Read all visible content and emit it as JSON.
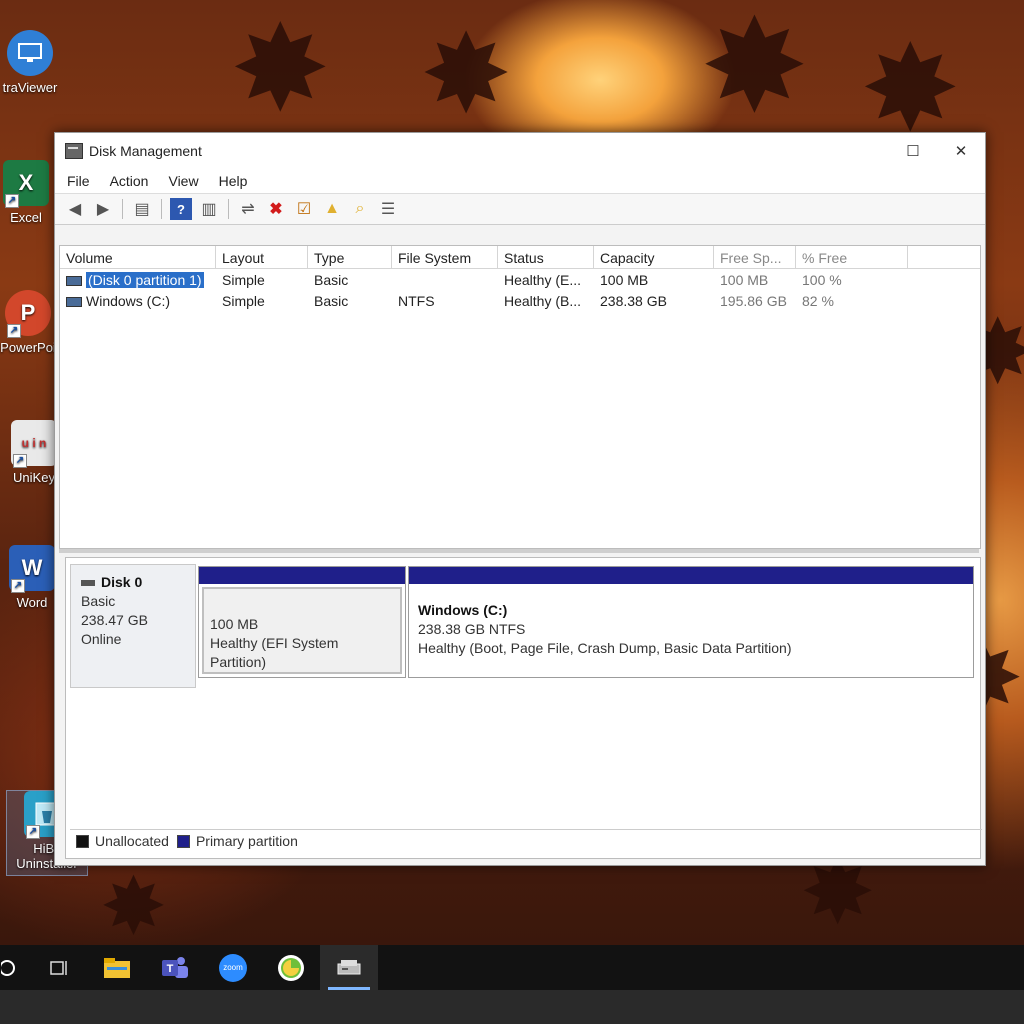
{
  "desktop": {
    "icons": [
      {
        "label": "traViewer",
        "icon": "ultraviewer-monitor-icon",
        "color": "#2f7fd6"
      },
      {
        "label": "Excel",
        "icon": "excel-icon",
        "color": "#1d7a43",
        "glyph": "X"
      },
      {
        "label": "PowerPoi",
        "icon": "powerpoint-icon",
        "color": "#d2472b",
        "glyph": "P"
      },
      {
        "label": "UniKey",
        "icon": "unikey-icon",
        "color": "#e9e9e9",
        "glyph": "u i n"
      },
      {
        "label": "Word",
        "icon": "word-icon",
        "color": "#2b5fb7",
        "glyph": "W"
      },
      {
        "label": "HiBit\nUninstaller",
        "label_line1": "HiBit",
        "label_line2": "Uninstaller",
        "icon": "hibit-uninstaller-icon",
        "color": "#2aa0c8"
      }
    ]
  },
  "window": {
    "title": "Disk Management",
    "controls": {
      "minimize": "—",
      "maximize": "☐",
      "close": "✕"
    }
  },
  "menu": [
    "File",
    "Action",
    "View",
    "Help"
  ],
  "toolbar": {
    "buttons": [
      "back-arrow-icon",
      "forward-arrow-icon",
      "console-tree-icon",
      "help-icon",
      "show-action-pane-icon",
      "connect-icon",
      "delete-icon",
      "properties-icon",
      "folder-up-icon",
      "folder-search-icon",
      "list-view-icon"
    ]
  },
  "volume_list": {
    "columns": [
      "Volume",
      "Layout",
      "Type",
      "File System",
      "Status",
      "Capacity",
      "Free Sp...",
      "% Free"
    ],
    "rows": [
      {
        "volume": "(Disk 0 partition 1)",
        "layout": "Simple",
        "type": "Basic",
        "file_system": "",
        "status": "Healthy (E...",
        "capacity": "100 MB",
        "free_space": "100 MB",
        "percent_free": "100 %",
        "selected": true
      },
      {
        "volume": "Windows (C:)",
        "layout": "Simple",
        "type": "Basic",
        "file_system": "NTFS",
        "status": "Healthy (B...",
        "capacity": "238.38 GB",
        "free_space": "195.86 GB",
        "percent_free": "82 %",
        "selected": false
      }
    ]
  },
  "disk": {
    "name": "Disk 0",
    "kind": "Basic",
    "size": "238.47 GB",
    "state": "Online",
    "partitions": [
      {
        "name": "",
        "size_line": "100 MB",
        "status_line": "Healthy (EFI System Partition)"
      },
      {
        "name": "Windows  (C:)",
        "size_line": "238.38 GB NTFS",
        "status_line": "Healthy (Boot, Page File, Crash Dump, Basic Data Partition)"
      }
    ]
  },
  "legend": [
    {
      "label": "Unallocated",
      "color": "#111111"
    },
    {
      "label": "Primary partition",
      "color": "#1f1f8a"
    }
  ],
  "taskbar": {
    "items": [
      "start-circle-icon",
      "task-view-icon",
      "file-explorer-icon",
      "teams-icon",
      "zoom-icon",
      "greenshot-icon",
      "disk-management-icon"
    ],
    "zoom_label": "zoom"
  }
}
